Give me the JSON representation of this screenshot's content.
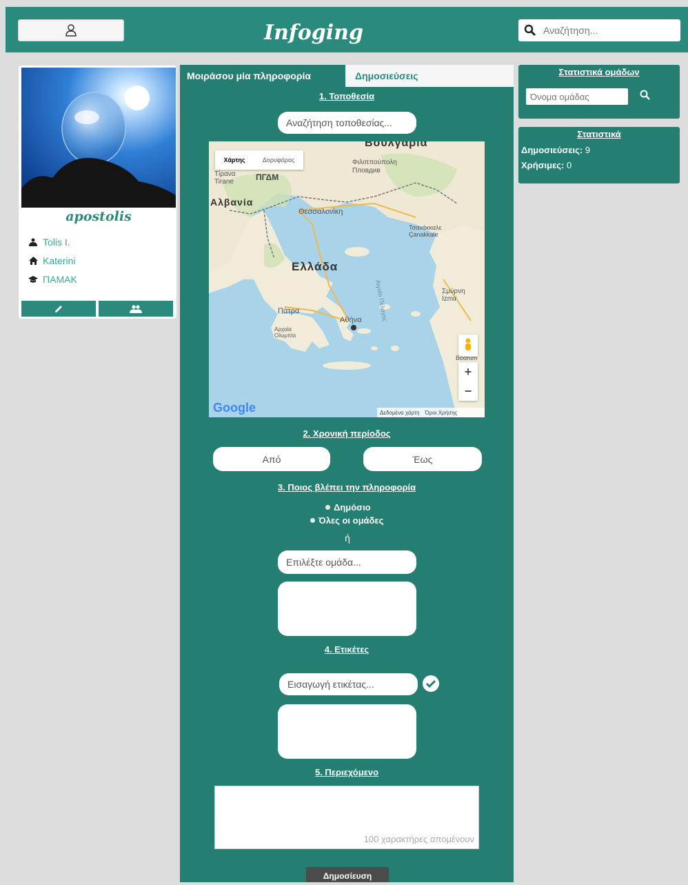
{
  "header": {
    "logo": "Infoging",
    "search_placeholder": "Αναζήτηση..."
  },
  "profile": {
    "username": "apostolis",
    "full_name": "Tolis I.",
    "city": "Katerini",
    "school": "ΠΑΜΑΚ"
  },
  "tabs": {
    "share": "Μοιράσου μία πληροφορία",
    "posts": "Δημοσιεύσεις"
  },
  "form": {
    "location_title": "1. Τοποθεσία",
    "location_placeholder": "Αναζήτηση τοποθεσίας...",
    "map": {
      "type_map": "Χάρτης",
      "type_satellite": "Δορυφόρος",
      "country_label": "Ελλάδα",
      "albania_label": "Αλβανία",
      "bulgaria_label": "Βουλγαρία",
      "fyrom_label": "ΠΓΔΜ",
      "tirana_label": "Τίρανα Tirane",
      "thessaloniki_label": "Θεσσαλονίκη",
      "philippopolis_label": "Φιλιππούπολη Пловдив",
      "patra_label": "Πάτρα",
      "athens_label": "Αθήνα",
      "smyrni_label": "Σμύρνη İzmir",
      "canakkale_label": "Τσανάκκαλε Çanakkale",
      "aigaio_label": "Αιγαίο Πέλαγος",
      "bodrum_label": "Bodrum",
      "olympia_label": "Αρχαία Ολυμπία",
      "google_label": "Google",
      "map_data_label": "Δεδομένα χάρτη",
      "terms_label": "Όροι Χρήσης",
      "zoom_in": "+",
      "zoom_out": "−"
    },
    "period_title": "2. Χρονική περίοδος",
    "from_placeholder": "Από",
    "to_placeholder": "Έως",
    "visibility_title": "3. Ποιος βλέπει την πληροφορία",
    "option_public": "Δημόσιο",
    "option_all_groups": "Όλες οι ομάδες",
    "or_label": "ή",
    "group_placeholder": "Επιλέξτε ομάδα...",
    "tags_title": "4. Ετικέτες",
    "tag_placeholder": "Εισαγωγή ετικέτας...",
    "content_title": "5. Περιεχόμενο",
    "content_counter": "100 χαρακτήρες απομένουν",
    "publish_label": "Δημοσίευση"
  },
  "right": {
    "group_stats_title": "Στατιστικά ομάδων",
    "group_name_placeholder": "Όνομα ομάδας",
    "stats_title": "Στατιστικά",
    "posts_label": "Δημοσιεύσεις:",
    "posts_value": "9",
    "useful_label": "Χρήσιμες:",
    "useful_value": "0"
  },
  "colors": {
    "brand": "#2a8a7b",
    "panel": "#247f72",
    "background": "#dcdcdc"
  }
}
